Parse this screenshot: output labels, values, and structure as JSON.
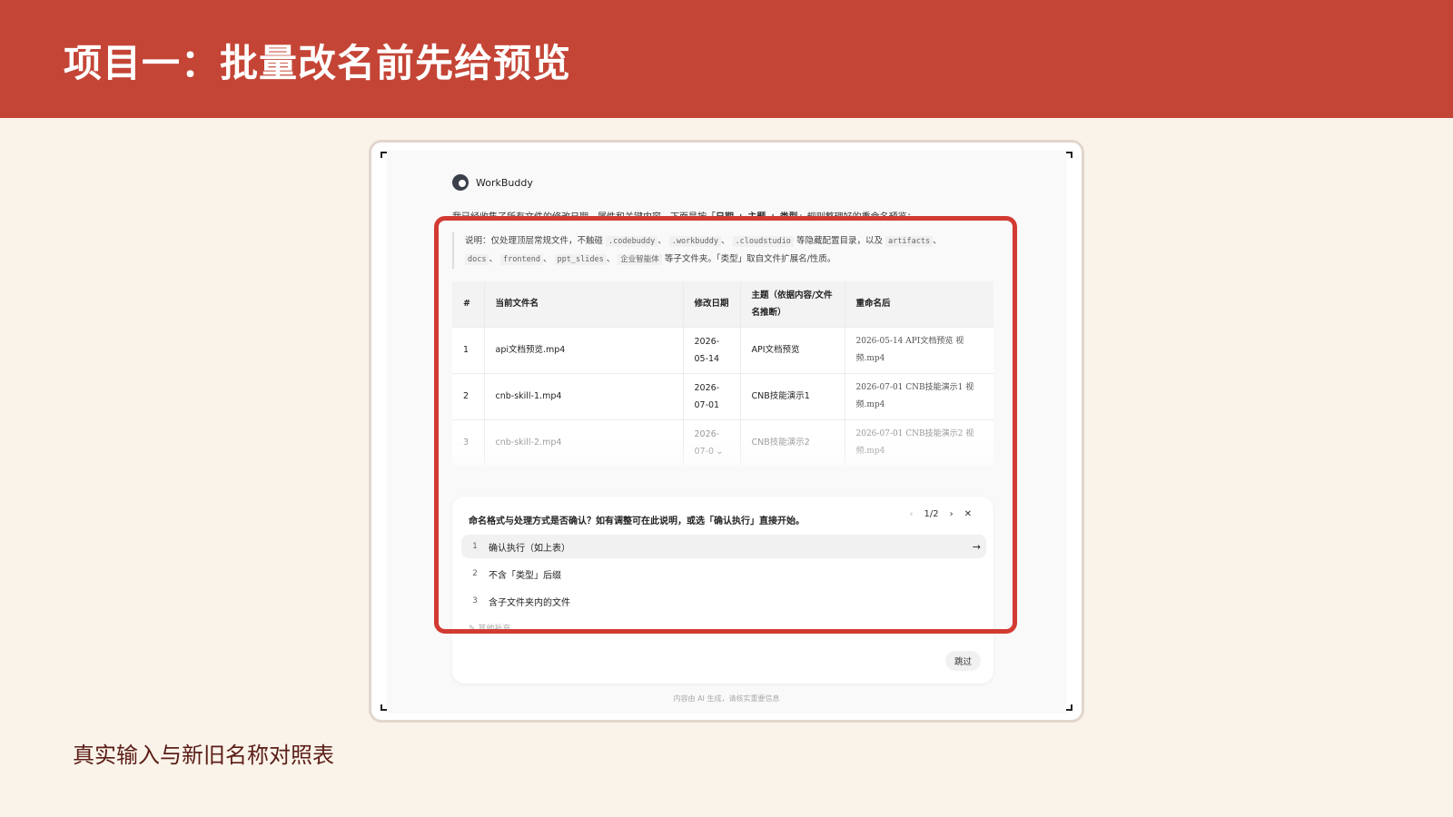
{
  "slide": {
    "title": "项目一：批量改名前先给预览",
    "caption": "真实输入与新旧名称对照表"
  },
  "app": {
    "name": "WorkBuddy",
    "intro_prefix": "我已经收集了所有文件的修改日期、属性和关键内容。下面是按「",
    "intro_rule": "日期 + 主题 + 类型",
    "intro_suffix": "」规则整理好的重命名预览："
  },
  "note": {
    "p1": "说明：仅处理顶层常规文件，不触碰",
    "c1": ".codebuddy",
    "sep1": "、",
    "c2": ".workbuddy",
    "sep2": "、",
    "c3": ".cloudstudio",
    "p2": "等隐藏配置目录，以及",
    "c4": "artifacts",
    "sep3": "、",
    "c5": "docs",
    "sep4": "、",
    "c6": "frontend",
    "sep5": "、",
    "c7": "ppt_slides",
    "sep6": "、",
    "c8": "企业智能体",
    "p3": "等子文件夹。「类型」取自文件扩展名/性质。"
  },
  "table": {
    "headers": [
      "#",
      "当前文件名",
      "修改日期",
      "主题（依据内容/文件名推断）",
      "重命名后"
    ],
    "rows": [
      {
        "no": "1",
        "current": "api文档预览.mp4",
        "date": "2026-05-14",
        "topic": "API文档预览",
        "renamed": "2026-05-14 API文档预览 视频.mp4"
      },
      {
        "no": "2",
        "current": "cnb-skill-1.mp4",
        "date": "2026-07-01",
        "topic": "CNB技能演示1",
        "renamed": "2026-07-01 CNB技能演示1 视频.mp4"
      },
      {
        "no": "3",
        "current": "cnb-skill-2.mp4",
        "date": "2026-07-0",
        "topic": "CNB技能演示2",
        "renamed": "2026-07-01 CNB技能演示2 视频.mp4"
      }
    ]
  },
  "question": {
    "text": "命名格式与处理方式是否确认？如有调整可在此说明，或选「确认执行」直接开始。",
    "page": "1/2",
    "options": [
      {
        "no": "1",
        "label": "确认执行（如上表）"
      },
      {
        "no": "2",
        "label": "不含「类型」后缀"
      },
      {
        "no": "3",
        "label": "含子文件夹内的文件"
      }
    ],
    "other": "其他补充...",
    "skip": "跳过"
  },
  "footer": "内容由 AI 生成，请核实重要信息",
  "colors": {
    "banner": "#c44536",
    "highlight": "#d23a32",
    "background": "#faf3ea"
  },
  "icons": {
    "prev": "chevron-left-icon",
    "next": "chevron-right-icon",
    "close": "close-icon",
    "submit": "arrow-right-icon",
    "edit": "pencil-icon"
  }
}
